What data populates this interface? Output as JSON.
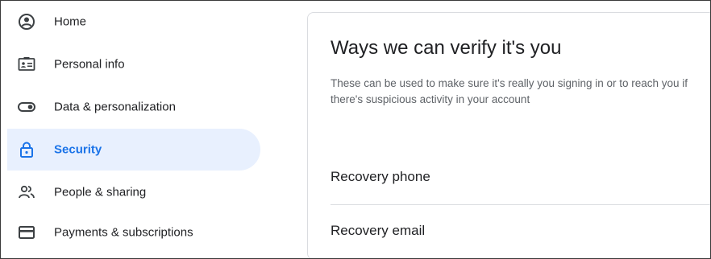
{
  "nav": {
    "items": [
      {
        "label": "Home",
        "icon": "account-circle-icon",
        "active": false
      },
      {
        "label": "Personal info",
        "icon": "id-card-icon",
        "active": false
      },
      {
        "label": "Data & personalization",
        "icon": "toggle-icon",
        "active": false
      },
      {
        "label": "Security",
        "icon": "lock-icon",
        "active": true
      },
      {
        "label": "People & sharing",
        "icon": "people-icon",
        "active": false
      },
      {
        "label": "Payments & subscriptions",
        "icon": "credit-card-icon",
        "active": false
      }
    ]
  },
  "card": {
    "title": "Ways we can verify it's you",
    "description": "These can be used to make sure it's really you signing in or to reach you if there's suspicious activity in your account",
    "rows": [
      {
        "label": "Recovery phone"
      },
      {
        "label": "Recovery email"
      }
    ]
  },
  "colors": {
    "accent": "#1a73e8",
    "active_bg": "#e8f0fe",
    "text_primary": "#202124",
    "text_secondary": "#5f6368",
    "divider": "#dadce0"
  }
}
